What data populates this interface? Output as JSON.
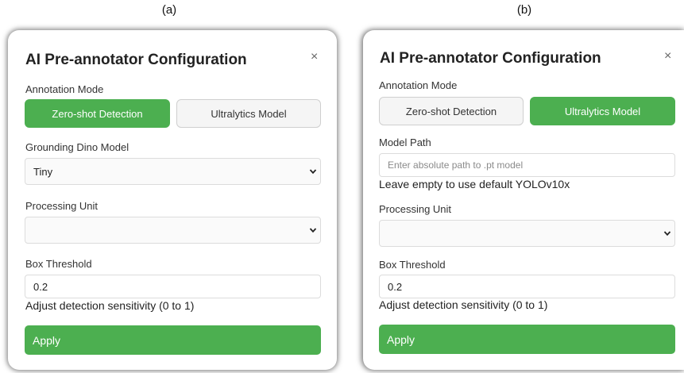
{
  "captions": {
    "a": "(a)",
    "b": "(b)"
  },
  "panel_a": {
    "title": "AI Pre-annotator Configuration",
    "close": "×",
    "mode_label": "Annotation Mode",
    "mode_buttons": [
      "Zero-shot Detection",
      "Ultralytics Model"
    ],
    "mode_selected": "Zero-shot Detection",
    "model_label": "Grounding Dino Model",
    "model_value": "Tiny",
    "unit_label": "Processing Unit",
    "unit_value": "",
    "threshold_label": "Box Threshold",
    "threshold_value": "0.2",
    "threshold_hint": "Adjust detection sensitivity (0 to 1)",
    "apply_label": "Apply"
  },
  "panel_b": {
    "title": "AI Pre-annotator Configuration",
    "close": "×",
    "mode_label": "Annotation Mode",
    "mode_buttons": [
      "Zero-shot Detection",
      "Ultralytics Model"
    ],
    "mode_selected": "Ultralytics Model",
    "path_label": "Model Path",
    "path_placeholder": "Enter absolute path to .pt model",
    "path_hint": "Leave empty to use default YOLOv10x",
    "unit_label": "Processing Unit",
    "unit_value": "",
    "threshold_label": "Box Threshold",
    "threshold_value": "0.2",
    "threshold_hint": "Adjust detection sensitivity (0 to 1)",
    "apply_label": "Apply"
  },
  "colors": {
    "accent": "#4caf50",
    "inactive_bg": "#f5f5f5"
  },
  "icons": {
    "close": "close-icon",
    "dropdown": "chevron-down-icon"
  }
}
